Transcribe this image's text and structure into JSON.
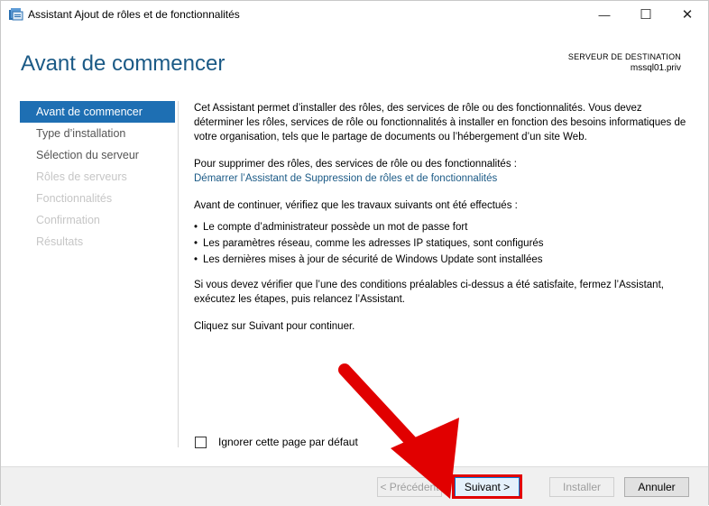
{
  "window": {
    "title": "Assistant Ajout de rôles et de fonctionnalités",
    "minimize": "—",
    "maximize": "☐",
    "close": "✕"
  },
  "header": {
    "title": "Avant de commencer",
    "destination_label": "SERVEUR DE DESTINATION",
    "destination_server": "mssql01.priv"
  },
  "nav": {
    "items": [
      {
        "label": "Avant de commencer",
        "state": "active"
      },
      {
        "label": "Type d’installation",
        "state": "enabled"
      },
      {
        "label": "Sélection du serveur",
        "state": "enabled"
      },
      {
        "label": "Rôles de serveurs",
        "state": "disabled"
      },
      {
        "label": "Fonctionnalités",
        "state": "disabled"
      },
      {
        "label": "Confirmation",
        "state": "disabled"
      },
      {
        "label": "Résultats",
        "state": "disabled"
      }
    ]
  },
  "content": {
    "intro": "Cet Assistant permet d’installer des rôles, des services de rôle ou des fonctionnalités. Vous devez déterminer les rôles, services de rôle ou fonctionnalités à installer en fonction des besoins informatiques de votre organisation, tels que le partage de documents ou l’hébergement d’un site Web.",
    "remove_text": "Pour supprimer des rôles, des services de rôle ou des fonctionnalités :",
    "remove_link": "Démarrer l’Assistant de Suppression de rôles et de fonctionnalités",
    "before_text": "Avant de continuer, vérifiez que les travaux suivants ont été effectués :",
    "bullets": [
      "Le compte d’administrateur possède un mot de passe fort",
      "Les paramètres réseau, comme les adresses IP statiques, sont configurés",
      "Les dernières mises à jour de sécurité de Windows Update sont installées"
    ],
    "verify_text": "Si vous devez vérifier que l’une des conditions préalables ci-dessus a été satisfaite, fermez l’Assistant, exécutez les étapes, puis relancez l’Assistant.",
    "next_text": "Cliquez sur Suivant pour continuer."
  },
  "checkbox": {
    "label": "Ignorer cette page par défaut",
    "checked": false
  },
  "buttons": {
    "previous": "< Précédent",
    "next": "Suivant >",
    "install": "Installer",
    "cancel": "Annuler"
  },
  "colors": {
    "accent": "#1e6fb3",
    "title": "#1b5a86",
    "annotation": "#e10000"
  }
}
